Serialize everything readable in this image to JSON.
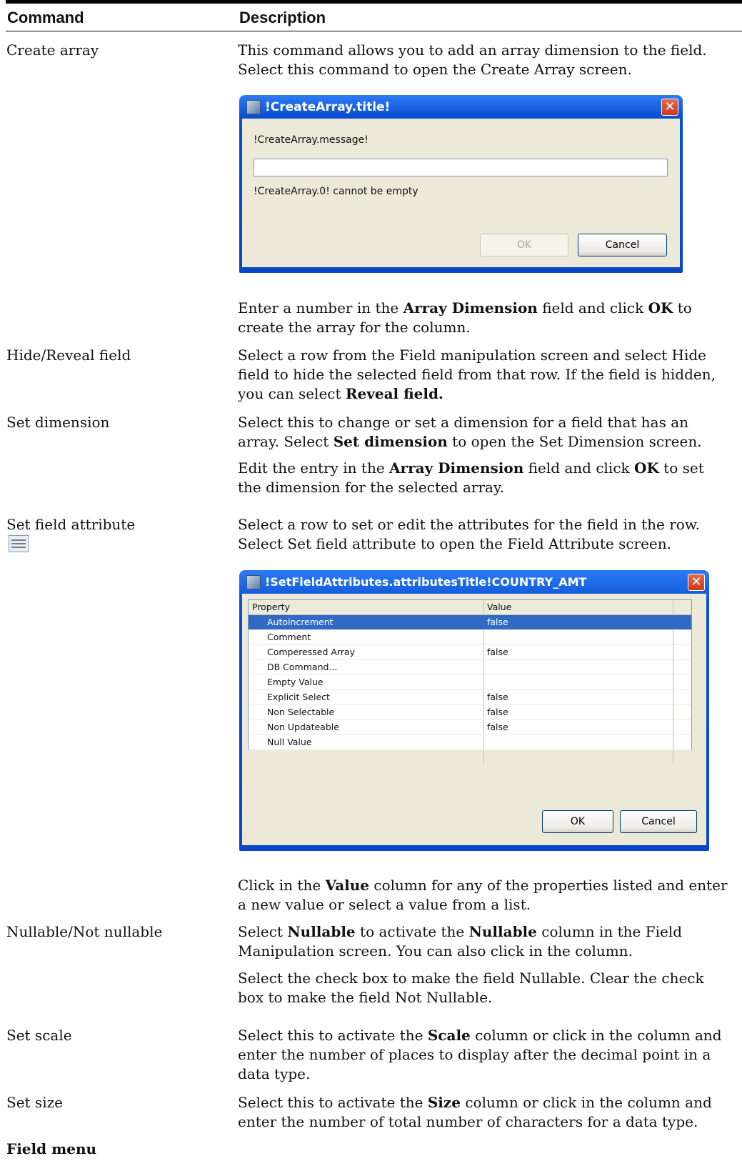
{
  "header": {
    "command": "Command",
    "description": "Description"
  },
  "rows": {
    "create_array": {
      "command": "Create array",
      "desc1": "This command allows you to add an array dimension to the field. Select this command to open the Create Array screen.",
      "dialog": {
        "title": "!CreateArray.title!",
        "message": "!CreateArray.message!",
        "input_value": "",
        "error": "!CreateArray.0! cannot be empty",
        "ok": "OK",
        "cancel": "Cancel"
      },
      "desc2_a": "Enter a number in the ",
      "desc2_b": "Array Dimension",
      "desc2_c": " field and click ",
      "desc2_d": "OK",
      "desc2_e": " to create the array for the column."
    },
    "hide_reveal": {
      "command": "Hide/Reveal field",
      "desc_a": "Select a row from the Field manipulation screen and select Hide field to hide the selected field from that row. If the field is hidden, you can select ",
      "desc_b": "Reveal field."
    },
    "set_dimension": {
      "command": "Set dimension",
      "desc1_a": "Select this to change or set a dimension for a field that has an array. Select ",
      "desc1_b": "Set dimension",
      "desc1_c": " to open the Set Dimension screen.",
      "desc2_a": "Edit the entry in the ",
      "desc2_b": "Array Dimension",
      "desc2_c": " field and click ",
      "desc2_d": "OK",
      "desc2_e": " to set the dimension for the selected array."
    },
    "set_field_attribute": {
      "command": "Set field attribute",
      "desc1": "Select a row to set or edit the attributes for the field in the row. Select Set field attribute to open the Field Attribute screen.",
      "dialog": {
        "title": "!SetFieldAttributes.attributesTitle!COUNTRY_AMT",
        "col_property": "Property",
        "col_value": "Value",
        "properties": [
          {
            "name": "Autoincrement",
            "value": "false"
          },
          {
            "name": "Comment",
            "value": ""
          },
          {
            "name": "Comperessed Array",
            "value": "false"
          },
          {
            "name": "DB Command...",
            "value": ""
          },
          {
            "name": "Empty Value",
            "value": ""
          },
          {
            "name": "Explicit Select",
            "value": "false"
          },
          {
            "name": "Non Selectable",
            "value": "false"
          },
          {
            "name": "Non Updateable",
            "value": "false"
          },
          {
            "name": "Null Value",
            "value": ""
          }
        ],
        "ok": "OK",
        "cancel": "Cancel"
      },
      "desc2_a": "Click in the ",
      "desc2_b": "Value",
      "desc2_c": " column for any of the properties listed and enter a new value or select a value from a list."
    },
    "nullable": {
      "command": "Nullable/Not nullable",
      "desc1_a": "Select ",
      "desc1_b": "Nullable",
      "desc1_c": " to activate the ",
      "desc1_d": "Nullable",
      "desc1_e": " column in the Field Manipulation screen. You can also click in the column.",
      "desc2": "Select the check box to make the field Nullable. Clear the check box to make the field Not Nullable."
    },
    "set_scale": {
      "command": "Set scale",
      "desc_a": "Select this to activate the ",
      "desc_b": "Scale",
      "desc_c": " column or click in the column and enter the number of places to display after the decimal point in a data type."
    },
    "set_size": {
      "command": "Set size",
      "desc_a": "Select this to activate the ",
      "desc_b": "Size",
      "desc_c": " column or click in the column and enter the number of total number of characters for a data type."
    }
  },
  "footer_heading": "Field menu",
  "icons": {
    "table_icon": "table-icon",
    "app_icon": "app-icon",
    "close_icon": "close-icon"
  }
}
